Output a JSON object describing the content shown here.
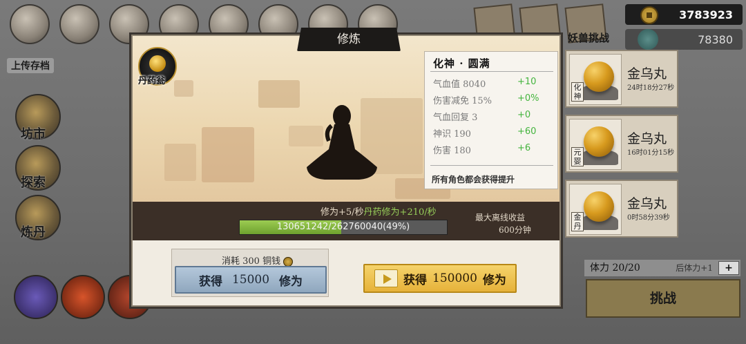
{
  "background": {
    "save_label": "上传存档",
    "side_menu": [
      "坊市",
      "探索",
      "炼丹"
    ],
    "beast_challenge_label": "妖兽挑战",
    "currency": {
      "coins": "3783923",
      "jade": "78380"
    },
    "rewards": [
      {
        "name": "金乌丸",
        "time": "24时18分27秒",
        "tag": "化神"
      },
      {
        "name": "金乌丸",
        "time": "16时01分15秒",
        "tag": "元婴"
      },
      {
        "name": "金乌丸",
        "time": "0时58分39秒",
        "tag": "金丹"
      }
    ],
    "stamina": {
      "label": "体力 20/20",
      "after": "后体力+1",
      "plus": "+"
    },
    "challenge_label": "挑战"
  },
  "modal": {
    "title": "修炼",
    "pill_badge_label": "丹药瓮",
    "stats": {
      "title": "化神 · 圆满",
      "rows": [
        {
          "name": "气血值 8040",
          "inc": "+10"
        },
        {
          "name": "伤害减免 15%",
          "inc": "+0%"
        },
        {
          "name": "气血回复 3",
          "inc": "+0"
        },
        {
          "name": "神识 190",
          "inc": "+60"
        },
        {
          "name": "伤害 180",
          "inc": "+6"
        }
      ],
      "note": "所有角色都会获得提升"
    },
    "rate": {
      "base": "修为+5/秒",
      "pill": "丹药修为+210/秒"
    },
    "progress": {
      "text": "130651242/262760040(49%)",
      "fraction": 0.49
    },
    "offline": {
      "label": "最大离线收益",
      "value": "600分钟"
    },
    "cost": {
      "text": "消耗 300 铜钱"
    },
    "gain_button": {
      "prefix": "获得",
      "amount": "15000",
      "suffix": "修为"
    },
    "video_button": {
      "prefix": "获得",
      "amount": "150000",
      "suffix": "修为"
    }
  },
  "colors": {
    "accent_green": "#43b43d",
    "progress_fill": "#7fb33a",
    "gold_button": "#e6b23a",
    "blue_button": "#8fa7be"
  }
}
